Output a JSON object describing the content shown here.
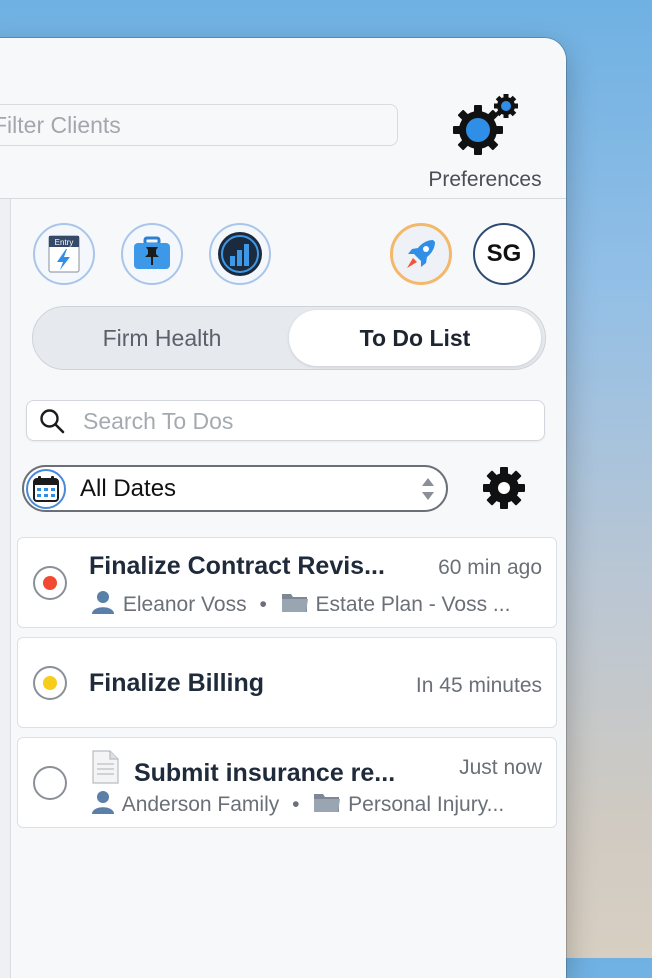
{
  "header": {
    "filter_placeholder": "Filter Clients",
    "preferences_label": "Preferences"
  },
  "toolbar": {
    "entry_badge": "Entry",
    "avatar_initials": "SG"
  },
  "tabs": {
    "left": "Firm Health",
    "right": "To Do List",
    "active": "To Do List"
  },
  "search": {
    "placeholder": "Search To Dos"
  },
  "date_filter": {
    "selected": "All Dates"
  },
  "todos": [
    {
      "title": "Finalize Contract Revis...",
      "time": "60 min ago",
      "person": "Eleanor Voss",
      "folder": "Estate Plan - Voss ...",
      "status_color": "#f04a32"
    },
    {
      "title": "Finalize Billing",
      "time": "In 45 minutes",
      "status_color": "#f8cc1a"
    },
    {
      "title": "Submit insurance re...",
      "time": "Just now",
      "person": "Anderson Family",
      "folder": "Personal Injury...",
      "status_color": ""
    }
  ],
  "colors": {
    "accent_blue": "#2f8fe6",
    "rocket_ring": "#f3b86a"
  }
}
